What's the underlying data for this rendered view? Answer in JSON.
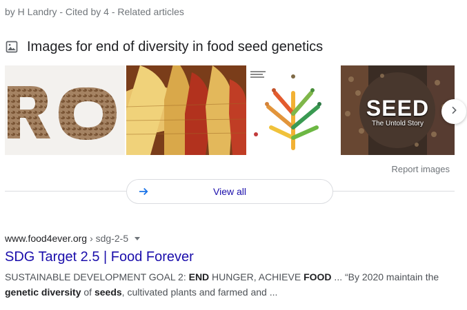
{
  "top": {
    "cited_line": "by H Landry - Cited by 4 - Related articles"
  },
  "images": {
    "header_title": "Images for end of diversity in food seed genetics",
    "thumb_4_text_main": "SEED",
    "thumb_4_text_sub": "The Untold Story",
    "report_label": "Report images",
    "view_all_label": "View all",
    "icons": {
      "header": "image-icon",
      "next": "chevron-right-icon",
      "view_all": "arrow-right-icon"
    }
  },
  "result": {
    "domain": "www.food4ever.org",
    "path": "› sdg-2-5",
    "title": "SDG Target 2.5 | Food Forever",
    "snippet_parts": [
      {
        "text": "SUSTAINABLE DEVELOPMENT GOAL 2: ",
        "bold": false
      },
      {
        "text": "END",
        "bold": true
      },
      {
        "text": " HUNGER, ACHIEVE ",
        "bold": false
      },
      {
        "text": "FOOD",
        "bold": true
      },
      {
        "text": " ... “By 2020 maintain the ",
        "bold": false
      },
      {
        "text": "genetic diversity",
        "bold": true
      },
      {
        "text": " of ",
        "bold": false
      },
      {
        "text": "seeds",
        "bold": true
      },
      {
        "text": ", cultivated plants and farmed and ...",
        "bold": false
      }
    ]
  },
  "colors": {
    "link": "#1a0dab",
    "meta": "#70757a",
    "text": "#4d5156",
    "divider": "#dadce0"
  }
}
